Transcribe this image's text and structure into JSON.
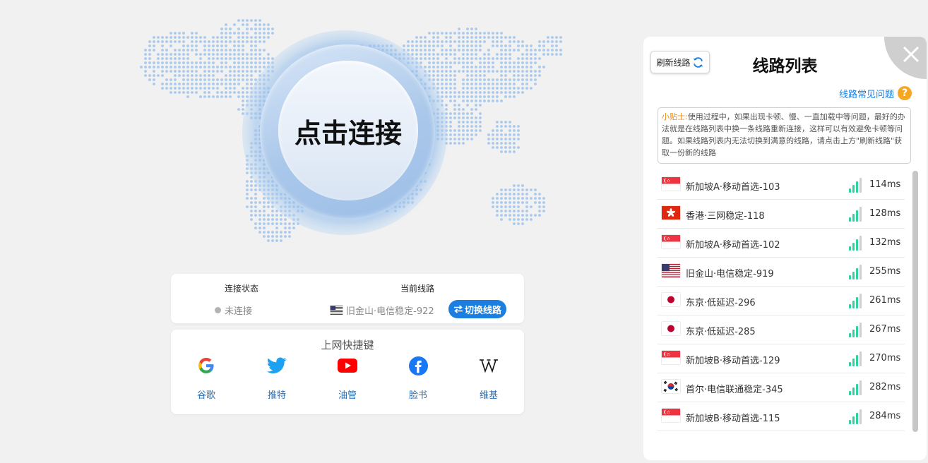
{
  "connect": {
    "label": "点击连接"
  },
  "status": {
    "connection_label": "连接状态",
    "connection_value": "未连接",
    "current_line_label": "当前线路",
    "current_line_value": "旧金山·电信稳定-922",
    "current_line_flag": "us",
    "switch_label": "切换线路"
  },
  "shortcuts": {
    "title": "上网快捷键",
    "items": [
      {
        "label": "谷歌",
        "icon": "google-icon"
      },
      {
        "label": "推特",
        "icon": "twitter-icon"
      },
      {
        "label": "油管",
        "icon": "youtube-icon"
      },
      {
        "label": "脸书",
        "icon": "facebook-icon"
      },
      {
        "label": "维基",
        "icon": "wikipedia-icon"
      }
    ]
  },
  "panel": {
    "refresh_label": "刷新线路",
    "title": "线路列表",
    "faq_label": "线路常见问题",
    "faq_icon": "?",
    "tip_prefix": "小贴士:",
    "tip_text": "使用过程中，如果出现卡顿、慢、一直加载中等问题，最好的办法就是在线路列表中换一条线路重新连接，这样可以有效避免卡顿等问题。如果线路列表内无法切换到满意的线路，请点击上方\"刷新线路\"获取一份新的线路",
    "servers": [
      {
        "name": "新加坡A·移动首选-103",
        "latency": "114ms",
        "flag": "sg"
      },
      {
        "name": "香港·三网稳定-118",
        "latency": "128ms",
        "flag": "hk"
      },
      {
        "name": "新加坡A·移动首选-102",
        "latency": "132ms",
        "flag": "sg"
      },
      {
        "name": "旧金山·电信稳定-919",
        "latency": "255ms",
        "flag": "us"
      },
      {
        "name": "东京·低延迟-296",
        "latency": "261ms",
        "flag": "jp"
      },
      {
        "name": "东京·低延迟-285",
        "latency": "267ms",
        "flag": "jp"
      },
      {
        "name": "新加坡B·移动首选-129",
        "latency": "270ms",
        "flag": "sg"
      },
      {
        "name": "首尔·电信联通稳定-345",
        "latency": "282ms",
        "flag": "kr"
      },
      {
        "name": "新加坡B·移动首选-115",
        "latency": "284ms",
        "flag": "sg"
      }
    ]
  },
  "colors": {
    "accent": "#1a7fe0",
    "signal": "#2ed3a0",
    "tip_prefix": "#f08c1a",
    "faq_icon": "#f5a623"
  }
}
